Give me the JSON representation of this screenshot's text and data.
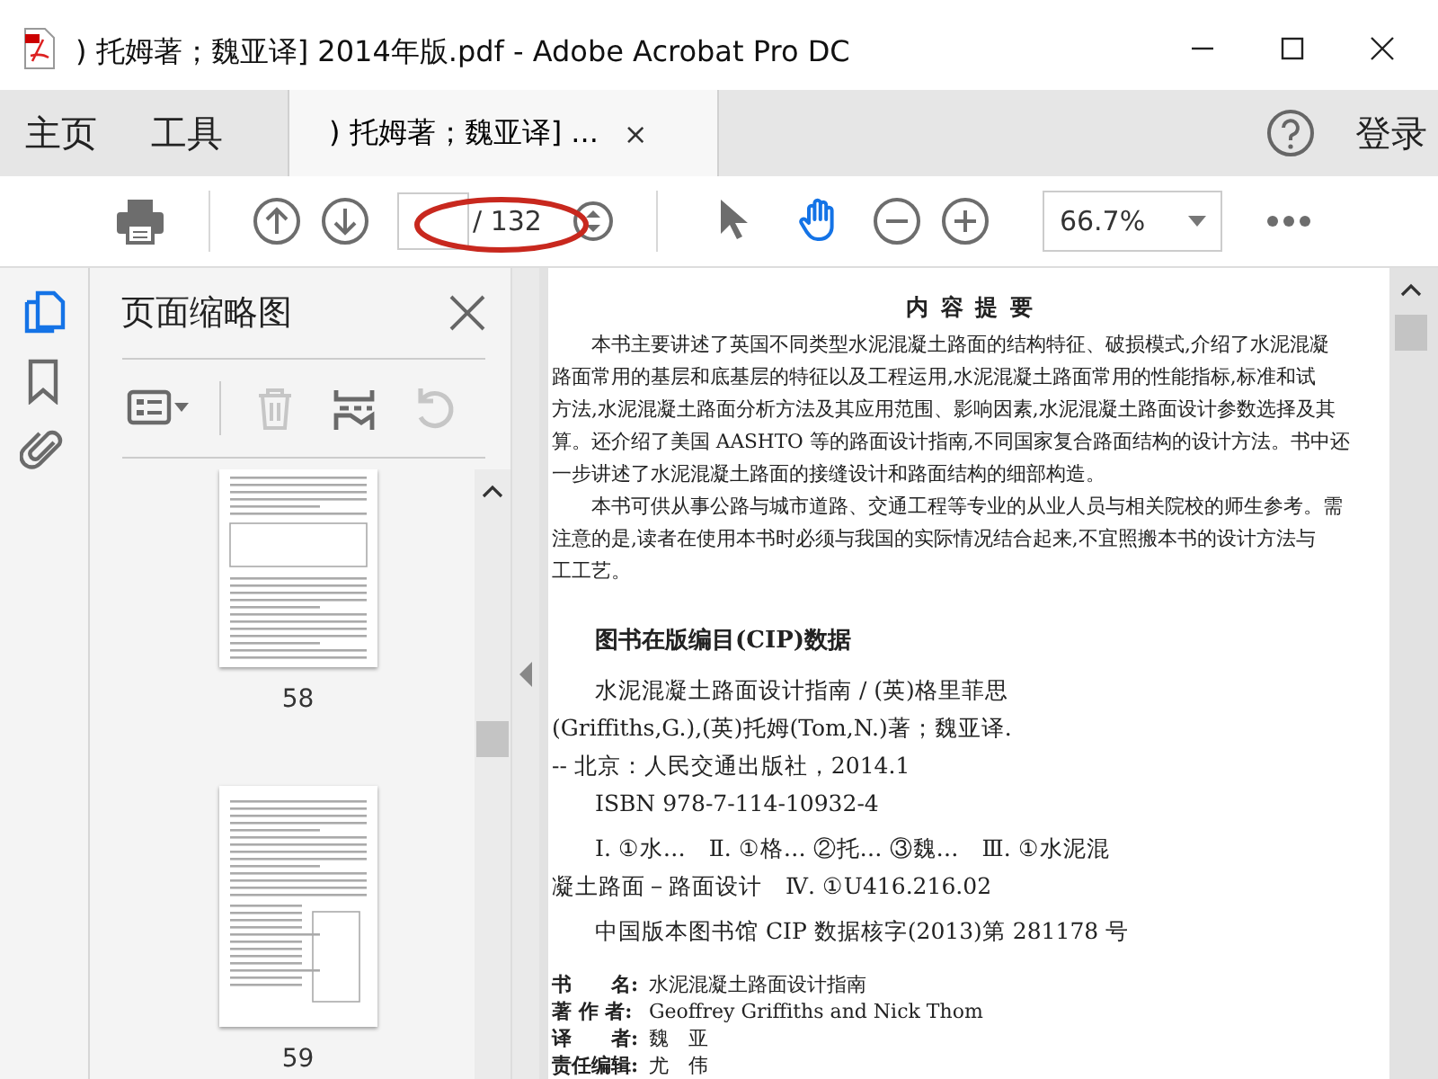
{
  "window": {
    "title": ") 托姆著；魏亚译] 2014年版.pdf - Adobe Acrobat Pro DC"
  },
  "menu_tabs": [
    {
      "label": "主页",
      "selected": false
    },
    {
      "label": "工具",
      "selected": false
    }
  ],
  "document_tab": {
    "label": ") 托姆著；魏亚译] ...",
    "selected": true,
    "close": "×"
  },
  "account": {
    "login": "登录"
  },
  "toolbar": {
    "page_total": "/ 132",
    "zoom": "66.7%",
    "tools": [
      {
        "kind": "select",
        "selected": false
      },
      {
        "kind": "hand",
        "selected": true
      }
    ]
  },
  "sidebar": {
    "rail": [
      {
        "kind": "pages",
        "selected": true
      },
      {
        "kind": "bookmarks",
        "selected": false
      },
      {
        "kind": "attachments",
        "selected": false
      }
    ],
    "panel_title": "页面缩略图",
    "panel_tools": [
      {
        "kind": "options",
        "disabled": false
      },
      {
        "kind": "delete",
        "disabled": true
      },
      {
        "kind": "extract",
        "disabled": false
      },
      {
        "kind": "rotate",
        "disabled": true
      }
    ],
    "thumbnails": [
      {
        "label": "58",
        "selected": false
      },
      {
        "label": "59",
        "selected": false
      }
    ]
  },
  "document": {
    "heading": "内 容 提 要",
    "summary_lines": [
      {
        "text": "本书主要讲述了英国不同类型水泥混凝土路面的结构特征、破损模式,介绍了水泥混凝",
        "indent": true
      },
      {
        "text": "路面常用的基层和底基层的特征以及工程运用,水泥混凝土路面常用的性能指标,标准和试",
        "indent": false
      },
      {
        "text": "方法,水泥混凝土路面分析方法及其应用范围、影响因素,水泥混凝土路面设计参数选择及其",
        "indent": false
      },
      {
        "text": "算。还介绍了美国 AASHTO 等的路面设计指南,不同国家复合路面结构的设计方法。书中还",
        "indent": false
      },
      {
        "text": "一步讲述了水泥混凝土路面的接缝设计和路面结构的细部构造。",
        "indent": false
      },
      {
        "text": "本书可供从事公路与城市道路、交通工程等专业的从业人员与相关院校的师生参考。需",
        "indent": true
      },
      {
        "text": "注意的是,读者在使用本书时必须与我国的实际情况结合起来,不宜照搬本书的设计方法与",
        "indent": false
      },
      {
        "text": "工工艺。",
        "indent": false
      }
    ],
    "cip_heading": "图书在版编目(CIP)数据",
    "cip_lines": [
      {
        "text": "水泥混凝土路面设计指南 / (英)格里菲思",
        "indent": true
      },
      {
        "text": "(Griffiths,G.),(英)托姆(Tom,N.)著；魏亚译.",
        "indent": false
      },
      {
        "text": "-- 北京：人民交通出版社，2014.1",
        "indent": false
      },
      {
        "text": "ISBN 978-7-114-10932-4",
        "indent": true
      },
      {
        "text": "Ⅰ. ①水…　Ⅱ. ①格… ②托… ③魏…　Ⅲ. ①水泥混",
        "indent": true
      },
      {
        "text": "凝土路面－路面设计　Ⅳ. ①U416.216.02",
        "indent": false
      },
      {
        "text": "中国版本图书馆 CIP 数据核字(2013)第 281178 号",
        "indent": true
      }
    ],
    "credits": [
      {
        "label": "书　　名:",
        "value": "水泥混凝土路面设计指南"
      },
      {
        "label": "著 作 者:",
        "value": "Geoffrey Griffiths and Nick Thom"
      },
      {
        "label": "译　　者:",
        "value": "魏　亚"
      },
      {
        "label": "责任编辑:",
        "value": "尤　伟"
      }
    ]
  }
}
